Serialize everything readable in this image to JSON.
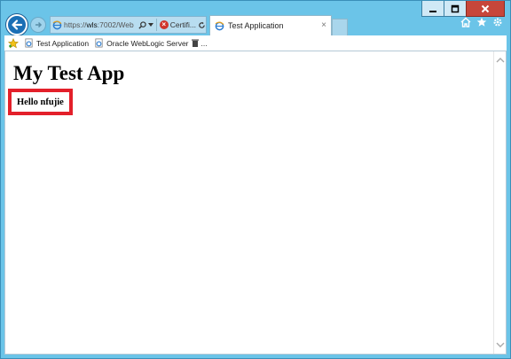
{
  "browser": {
    "address": {
      "scheme": "https://",
      "host": "wls",
      "rest": ":7002/Web",
      "cert_label": "Certifi..."
    },
    "tab": {
      "title": "Test Application",
      "close_glyph": "×"
    }
  },
  "favorites": {
    "items": [
      {
        "label": "Test Application"
      },
      {
        "label": "Oracle WebLogic Server"
      }
    ],
    "overflow": "..."
  },
  "page": {
    "title": "My Test App",
    "greeting": "Hello nfujie"
  },
  "colors": {
    "frame": "#6bc4e8",
    "highlight_border": "#e3202a",
    "close_button": "#c7463a",
    "back_button": "#1a6fb5"
  },
  "icons": {
    "back": "back-arrow-icon",
    "forward": "forward-arrow-icon",
    "site": "ie-page-icon",
    "search": "search-icon",
    "cert_error": "certificate-error-icon",
    "refresh": "refresh-icon",
    "home": "home-icon",
    "favorites": "star-icon",
    "tools": "gear-icon",
    "add_favorites": "add-favorites-icon"
  }
}
